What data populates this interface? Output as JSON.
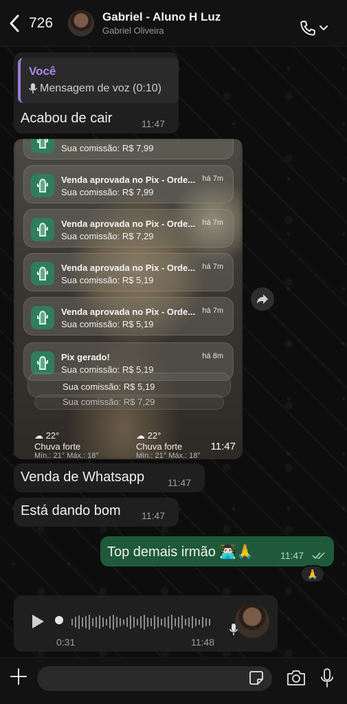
{
  "header": {
    "back_count": "726",
    "contact_name": "Gabriel - Aluno H Luz",
    "contact_subtitle": "Gabriel Oliveira"
  },
  "messages": {
    "reply": {
      "quote_author": "Você",
      "quote_text": "Mensagem de voz (0:10)",
      "text": "Acabou de cair",
      "time": "11:47"
    },
    "image": {
      "time": "11:47",
      "notifications": [
        {
          "title": "",
          "body": "Sua comissão: R$ 7,99",
          "time": ""
        },
        {
          "title": "Venda aprovada no Pix - Orde...",
          "body": "Sua comissão: R$ 7,99",
          "time": "há 7m"
        },
        {
          "title": "Venda aprovada no Pix - Orde...",
          "body": "Sua comissão: R$ 7,29",
          "time": "há 7m"
        },
        {
          "title": "Venda aprovada no Pix - Orde...",
          "body": "Sua comissão: R$ 5,19",
          "time": "há 7m"
        },
        {
          "title": "Venda aprovada no Pix - Orde...",
          "body": "Sua comissão: R$ 5,19",
          "time": "há 7m"
        },
        {
          "title": "Pix gerado!",
          "body": "Sua comissão: R$ 5,19",
          "time": "há 8m"
        },
        {
          "title": "",
          "body": "Sua comissão: R$ 5,19",
          "time": ""
        },
        {
          "title": "",
          "body": "Sua comissão: R$ 7,29",
          "time": ""
        }
      ],
      "weather": [
        {
          "temp": "22°",
          "desc": "Chuva forte",
          "minmax": "Mín.: 21° Máx.: 18°"
        },
        {
          "temp": "22°",
          "desc": "Chuva forte",
          "minmax": "Mín.: 21° Máx.: 18°"
        }
      ]
    },
    "incoming_1": {
      "text": "Venda de Whatsapp",
      "time": "11:47"
    },
    "incoming_2": {
      "text": "Está dando bom",
      "time": "11:47"
    },
    "outgoing": {
      "text": "Top demais irmão 👨🏻‍💻🙏",
      "time": "11:47",
      "reaction": "🙏"
    },
    "voice": {
      "duration": "0:31",
      "time": "11:48"
    }
  },
  "composer": {
    "placeholder": ""
  },
  "colors": {
    "accent_green": "#1e5a3a",
    "quote_purple": "#a988ea",
    "bubble_dark": "#1f1f1f"
  },
  "icons": [
    "chevron-left-icon",
    "phone-icon",
    "chevron-down-icon",
    "mic-icon",
    "forward-icon",
    "play-icon",
    "plus-icon",
    "sticker-icon",
    "camera-icon",
    "double-check-icon"
  ]
}
